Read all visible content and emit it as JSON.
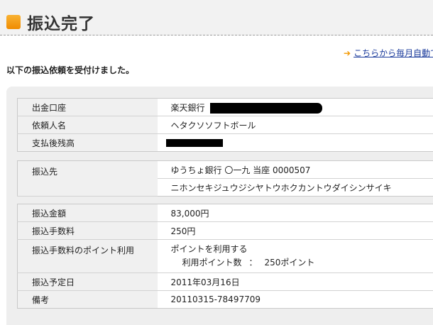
{
  "header": {
    "title": "振込完了",
    "icon": "orange-square-icon",
    "accent": "#f39800"
  },
  "top_link": {
    "arrow": "➔",
    "text": "こちらから毎月自動で"
  },
  "intro": "以下の振込依頼を受付けました。",
  "account": {
    "rows": [
      {
        "label": "出金口座",
        "value": "楽天銀行"
      },
      {
        "label": "依頼人名",
        "value": "ヘタクソソフトボール"
      },
      {
        "label": "支払後残高",
        "value": ""
      }
    ]
  },
  "payee": {
    "label": "振込先",
    "bank_line": "ゆうちょ銀行 〇一九 当座 0000507",
    "name_line": "ニホンセキジュウジシヤトウホクカントウダイシンサイキ"
  },
  "transfer": {
    "amount": {
      "label": "振込金額",
      "value": "83,000円"
    },
    "fee": {
      "label": "振込手数料",
      "value": "250円"
    },
    "points": {
      "label": "振込手数料のポイント利用",
      "line1": "ポイントを利用する",
      "line2_label": "利用ポイント数",
      "line2_sep": "：",
      "line2_value": "250ポイント"
    },
    "date": {
      "label": "振込予定日",
      "value": "2011年03月16日"
    },
    "note": {
      "label": "備考",
      "value": "20110315-78497709"
    }
  }
}
